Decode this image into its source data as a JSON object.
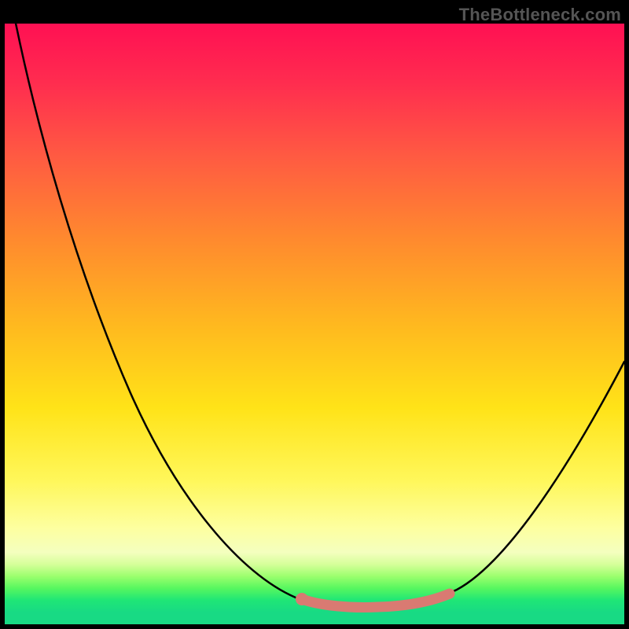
{
  "watermark": "TheBottleneck.com",
  "colors": {
    "gradient_top": "#ff1053",
    "gradient_mid": "#ffe318",
    "gradient_bottom": "#18da84",
    "curve": "#000000",
    "highlight": "#d97a72",
    "frame": "#000000",
    "watermark_text": "#555555"
  },
  "chart_data": {
    "type": "line",
    "title": "",
    "xlabel": "",
    "ylabel": "",
    "xlim": [
      0,
      100
    ],
    "ylim": [
      0,
      100
    ],
    "grid": false,
    "legend": false,
    "series": [
      {
        "name": "curve",
        "x": [
          1,
          8,
          20,
          30,
          38,
          47,
          54,
          60,
          66,
          72,
          80,
          91,
          100
        ],
        "values": [
          103,
          83,
          57,
          38,
          22,
          10,
          5,
          3,
          3,
          6,
          12,
          30,
          44
        ],
        "color": "#000000"
      },
      {
        "name": "highlight",
        "x": [
          48,
          54,
          60,
          66,
          72
        ],
        "values": [
          8,
          5,
          3,
          3,
          6
        ],
        "color": "#d97a72",
        "thick": true
      }
    ],
    "background": {
      "kind": "vertical-gradient",
      "stops": [
        {
          "pos": 0.0,
          "color": "#ff1053"
        },
        {
          "pos": 0.35,
          "color": "#ff8a2e"
        },
        {
          "pos": 0.6,
          "color": "#ffe318"
        },
        {
          "pos": 0.85,
          "color": "#fdffa0"
        },
        {
          "pos": 0.95,
          "color": "#57f75f"
        },
        {
          "pos": 1.0,
          "color": "#18da84"
        }
      ]
    }
  }
}
